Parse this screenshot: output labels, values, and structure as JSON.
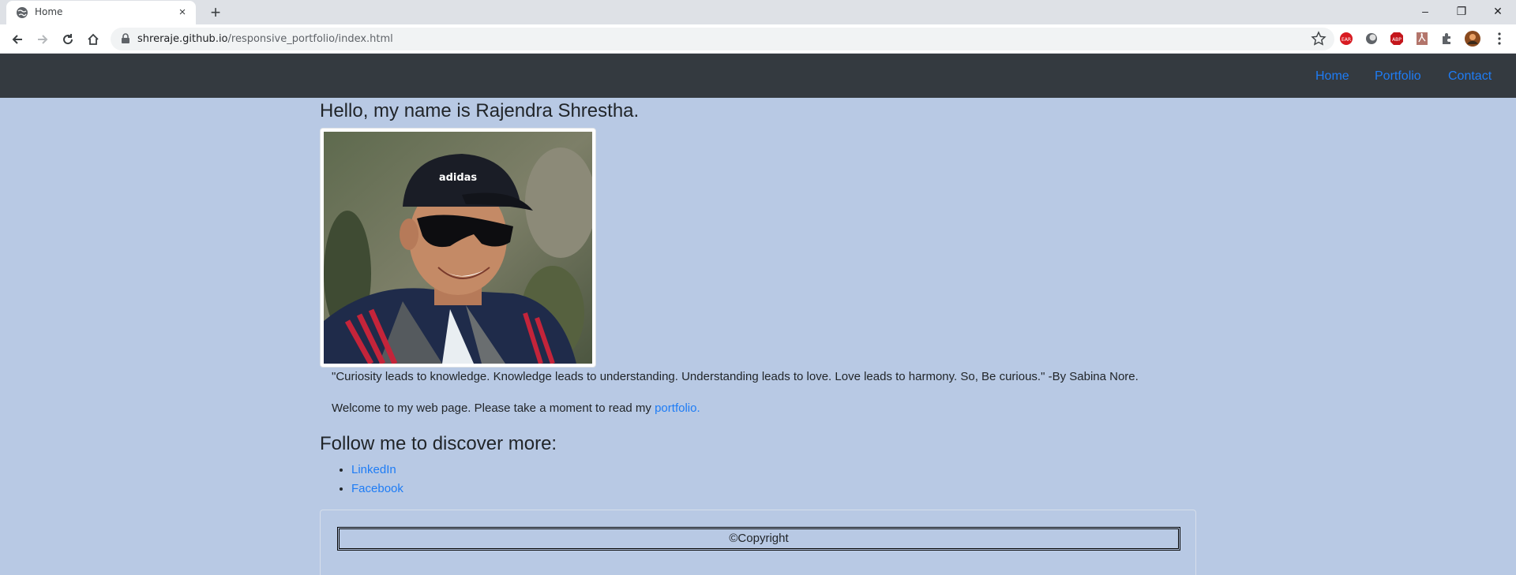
{
  "browser": {
    "tab_title": "Home",
    "tab_close": "×",
    "new_tab": "+",
    "url_host": "shreraje.github.io",
    "url_path": "/responsive_portfolio/index.html",
    "window_controls": [
      "–",
      "❐",
      "✕"
    ]
  },
  "nav": {
    "items": [
      "Home",
      "Portfolio",
      "Contact"
    ]
  },
  "main": {
    "heading": "Hello, my name is Rajendra Shrestha.",
    "quote": "\"Curiosity leads to knowledge. Knowledge leads to understanding. Understanding leads to love. Love leads to harmony. So, Be curious.\" -By Sabina Nore.",
    "welcome_text": "Welcome to my web page. Please take a moment to read my ",
    "welcome_link": "portfolio.",
    "follow_heading": "Follow me to discover more:",
    "social_links": [
      "LinkedIn",
      "Facebook"
    ]
  },
  "footer": {
    "copyright": "©Copyright"
  },
  "colors": {
    "page_bg": "#b8c9e4",
    "navbar_bg": "#343a40",
    "link": "#1e7cf5"
  }
}
